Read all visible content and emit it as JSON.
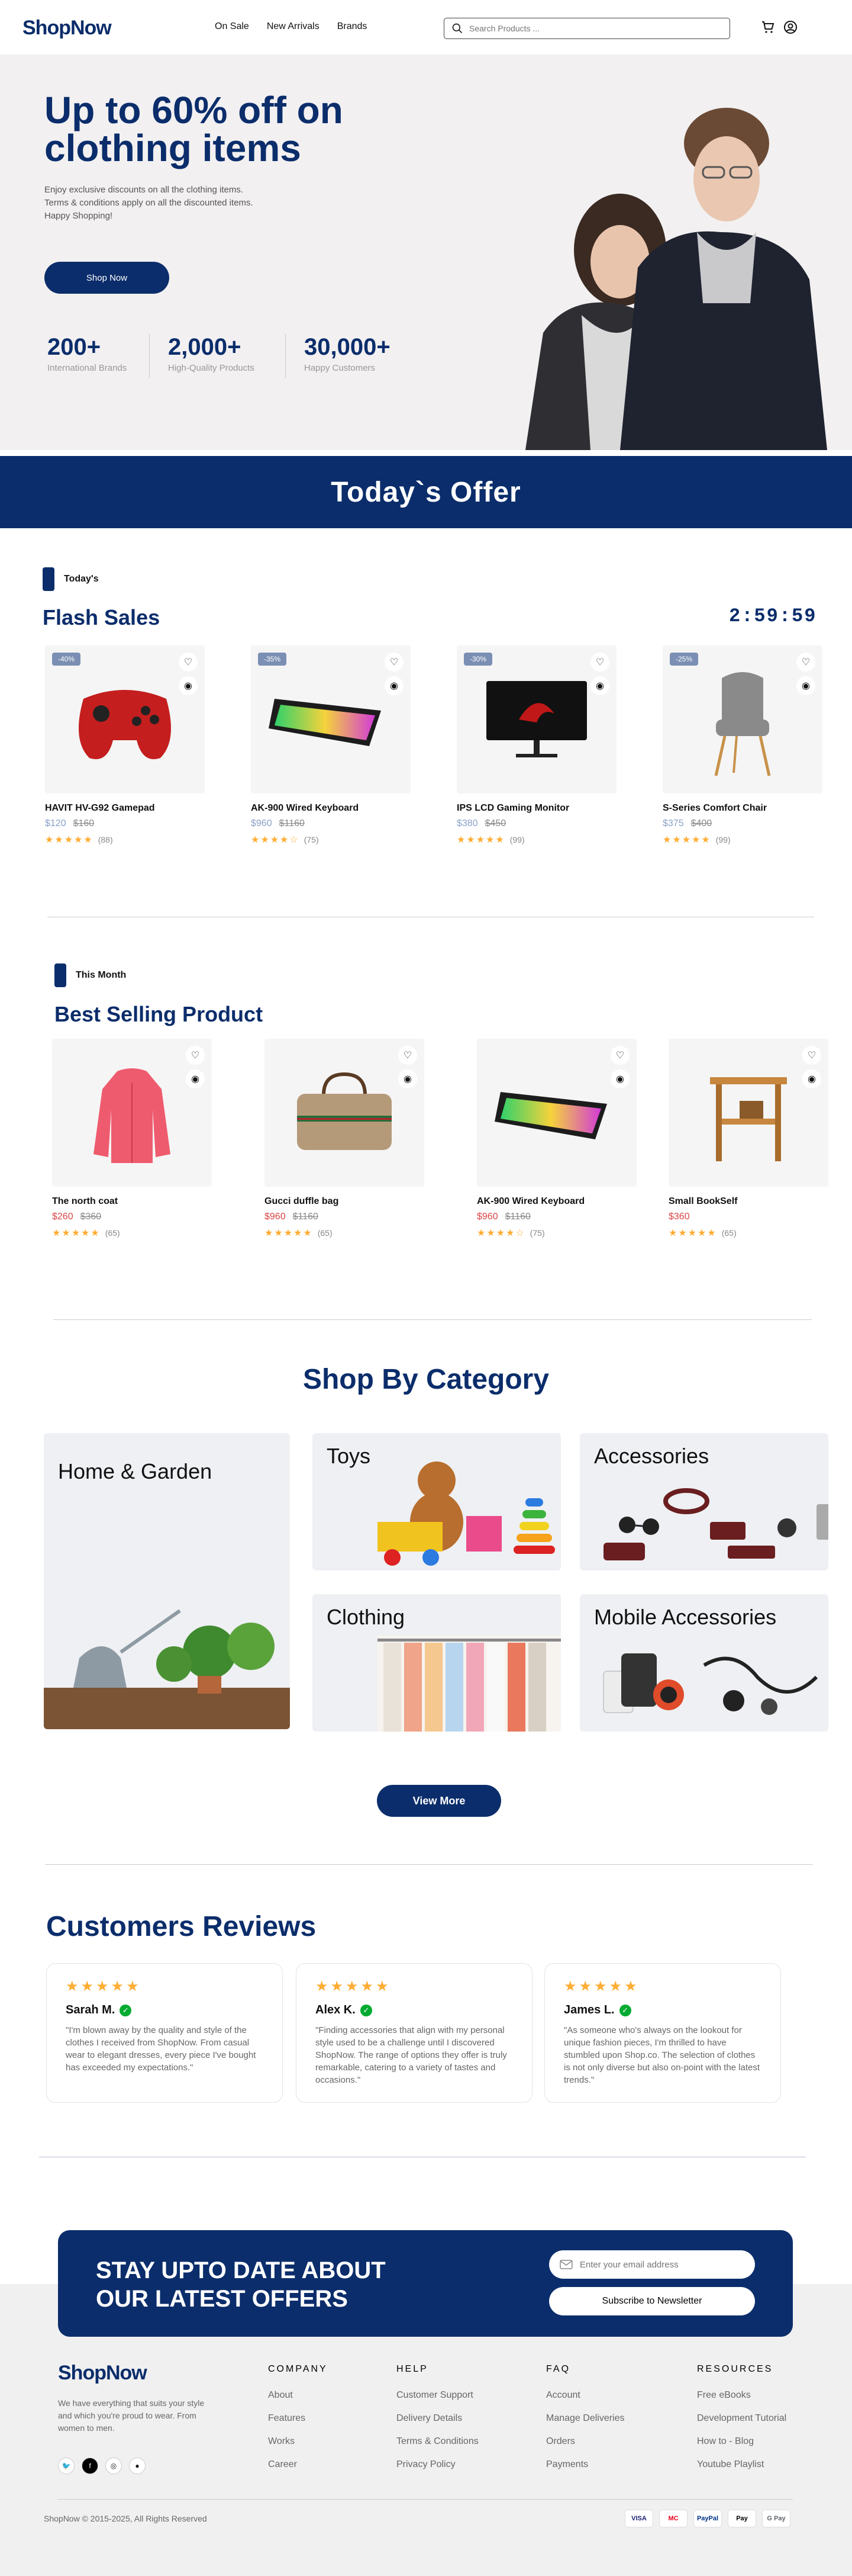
{
  "header": {
    "logo": "ShopNow",
    "nav": [
      "On Sale",
      "New Arrivals",
      "Brands"
    ],
    "search_placeholder": "Search Products ..."
  },
  "hero": {
    "title": "Up to 60% off on clothing items",
    "subtitle_lines": [
      "Enjoy exclusive discounts on all the clothing items.",
      "Terms & conditions apply on all the discounted items.",
      "Happy Shopping!"
    ],
    "cta": "Shop Now",
    "stats": [
      {
        "value": "200+",
        "label": "International Brands"
      },
      {
        "value": "2,000+",
        "label": "High-Quality Products"
      },
      {
        "value": "30,000+",
        "label": "Happy Customers"
      }
    ]
  },
  "offer": {
    "title": "Today`s Offer"
  },
  "flash": {
    "tag": "Today's",
    "title": "Flash Sales",
    "timer": "2:59:59",
    "products": [
      {
        "badge": "-40%",
        "name": "HAVIT HV-G92 Gamepad",
        "price": "$120",
        "old": "$160",
        "stars": "★★★★★",
        "reviews": "(88)",
        "icon": "gamepad-icon"
      },
      {
        "badge": "-35%",
        "name": "AK-900 Wired Keyboard",
        "price": "$960",
        "old": "$1160",
        "stars": "★★★★☆",
        "reviews": "(75)",
        "icon": "keyboard-icon"
      },
      {
        "badge": "-30%",
        "name": "IPS LCD Gaming Monitor",
        "price": "$380",
        "old": "$450",
        "stars": "★★★★★",
        "reviews": "(99)",
        "icon": "monitor-icon"
      },
      {
        "badge": "-25%",
        "name": "S-Series Comfort Chair",
        "price": "$375",
        "old": "$400",
        "stars": "★★★★★",
        "reviews": "(99)",
        "icon": "chair-icon"
      }
    ]
  },
  "best": {
    "tag": "This Month",
    "title": "Best Selling Product",
    "products": [
      {
        "name": "The north coat",
        "price": "$260",
        "old": "$360",
        "stars": "★★★★★",
        "reviews": "(65)",
        "icon": "coat-icon"
      },
      {
        "name": "Gucci duffle bag",
        "price": "$960",
        "old": "$1160",
        "stars": "★★★★★",
        "reviews": "(65)",
        "icon": "bag-icon"
      },
      {
        "name": "AK-900 Wired Keyboard",
        "price": "$960",
        "old": "$1160",
        "stars": "★★★★☆",
        "reviews": "(75)",
        "icon": "keyboard-icon"
      },
      {
        "name": "Small BookSelf",
        "price": "$360",
        "old": "",
        "stars": "★★★★★",
        "reviews": "(65)",
        "icon": "bookshelf-icon"
      }
    ]
  },
  "categories": {
    "title": "Shop By Category",
    "items": [
      "Home & Garden",
      "Toys",
      "Accessories",
      "Clothing",
      "Mobile Accessories"
    ],
    "view_more": "View More"
  },
  "reviews": {
    "title": "Customers Reviews",
    "items": [
      {
        "name": "Sarah M.",
        "stars": "★★★★★",
        "text": "\"I'm blown away by the quality and style of the clothes I received from ShopNow. From casual wear to elegant dresses, every piece I've bought has exceeded my expectations.\""
      },
      {
        "name": "Alex K.",
        "stars": "★★★★★",
        "text": "\"Finding accessories  that align with my personal style used to be a challenge until I discovered ShopNow. The range of options they offer is truly remarkable, catering to a variety of tastes and occasions.\""
      },
      {
        "name": "James L.",
        "stars": "★★★★★",
        "text": "\"As someone who's always on the lookout for unique fashion pieces, I'm thrilled to have stumbled upon Shop.co. The selection of clothes is not only diverse but also on-point with the latest trends.\""
      }
    ]
  },
  "newsletter": {
    "title_line1": "STAY UPTO DATE ABOUT",
    "title_line2": "OUR LATEST OFFERS",
    "placeholder": "Enter your email address",
    "button": "Subscribe to Newsletter"
  },
  "footer": {
    "logo": "ShopNow",
    "desc": "We have everything that suits your style and which you're proud to wear. From women to men.",
    "columns": [
      {
        "title": "COMPANY",
        "links": [
          "About",
          "Features",
          "Works",
          "Career"
        ]
      },
      {
        "title": "HELP",
        "links": [
          "Customer Support",
          "Delivery Details",
          "Terms & Conditions",
          "Privacy Policy"
        ]
      },
      {
        "title": "FAQ",
        "links": [
          "Account",
          "Manage Deliveries",
          "Orders",
          "Payments"
        ]
      },
      {
        "title": "RESOURCES",
        "links": [
          "Free eBooks",
          "Development Tutorial",
          "How to - Blog",
          "Youtube Playlist"
        ]
      }
    ],
    "copyright": "ShopNow © 2015-2025, All Rights Reserved",
    "payments": [
      "VISA",
      "MC",
      "PayPal",
      "Pay",
      "G Pay"
    ]
  },
  "colors": {
    "brand": "#0b2d6b",
    "sale": "#db4444",
    "star": "#ffad33"
  }
}
